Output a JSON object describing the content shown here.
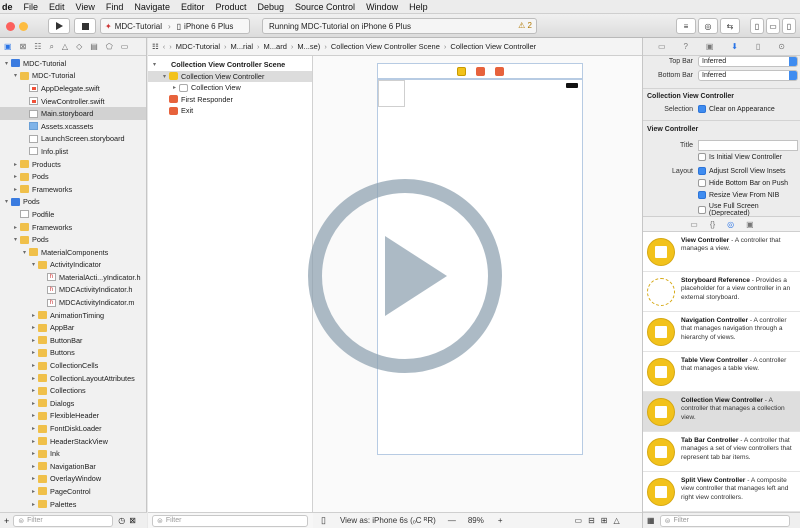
{
  "menubar": {
    "app": "de",
    "items": [
      "File",
      "Edit",
      "View",
      "Find",
      "Navigate",
      "Editor",
      "Product",
      "Debug",
      "Source Control",
      "Window",
      "Help"
    ]
  },
  "toolbar": {
    "scheme": "MDC-Tutorial",
    "device": "iPhone 6 Plus",
    "status": "Running MDC-Tutorial on iPhone 6 Plus",
    "warning_count": "2"
  },
  "navigator": {
    "tree": [
      {
        "label": "MDC-Tutorial",
        "indent": 0,
        "disc": "▾",
        "icon": "proj"
      },
      {
        "label": "MDC-Tutorial",
        "indent": 1,
        "disc": "▾",
        "icon": "folder"
      },
      {
        "label": "AppDelegate.swift",
        "indent": 2,
        "disc": "",
        "icon": "swift"
      },
      {
        "label": "ViewController.swift",
        "indent": 2,
        "disc": "",
        "icon": "swift"
      },
      {
        "label": "Main.storyboard",
        "indent": 2,
        "disc": "",
        "icon": "sb",
        "selected": true
      },
      {
        "label": "Assets.xcassets",
        "indent": 2,
        "disc": "",
        "icon": "assets"
      },
      {
        "label": "LaunchScreen.storyboard",
        "indent": 2,
        "disc": "",
        "icon": "sb"
      },
      {
        "label": "Info.plist",
        "indent": 2,
        "disc": "",
        "icon": "file"
      },
      {
        "label": "Products",
        "indent": 1,
        "disc": "▸",
        "icon": "folder"
      },
      {
        "label": "Pods",
        "indent": 1,
        "disc": "▸",
        "icon": "folder"
      },
      {
        "label": "Frameworks",
        "indent": 1,
        "disc": "▸",
        "icon": "folder"
      },
      {
        "label": "Pods",
        "indent": 0,
        "disc": "▾",
        "icon": "proj"
      },
      {
        "label": "Podfile",
        "indent": 1,
        "disc": "",
        "icon": "file"
      },
      {
        "label": "Frameworks",
        "indent": 1,
        "disc": "▸",
        "icon": "folder"
      },
      {
        "label": "Pods",
        "indent": 1,
        "disc": "▾",
        "icon": "folder"
      },
      {
        "label": "MaterialComponents",
        "indent": 2,
        "disc": "▾",
        "icon": "folder"
      },
      {
        "label": "ActivityIndicator",
        "indent": 3,
        "disc": "▾",
        "icon": "folder"
      },
      {
        "label": "MaterialActi...yIndicator.h",
        "indent": 4,
        "disc": "",
        "icon": "h"
      },
      {
        "label": "MDCActivityIndicator.h",
        "indent": 4,
        "disc": "",
        "icon": "h"
      },
      {
        "label": "MDCActivityIndicator.m",
        "indent": 4,
        "disc": "",
        "icon": "h"
      },
      {
        "label": "AnimationTiming",
        "indent": 3,
        "disc": "▸",
        "icon": "folder"
      },
      {
        "label": "AppBar",
        "indent": 3,
        "disc": "▸",
        "icon": "folder"
      },
      {
        "label": "ButtonBar",
        "indent": 3,
        "disc": "▸",
        "icon": "folder"
      },
      {
        "label": "Buttons",
        "indent": 3,
        "disc": "▸",
        "icon": "folder"
      },
      {
        "label": "CollectionCells",
        "indent": 3,
        "disc": "▸",
        "icon": "folder"
      },
      {
        "label": "CollectionLayoutAttributes",
        "indent": 3,
        "disc": "▸",
        "icon": "folder"
      },
      {
        "label": "Collections",
        "indent": 3,
        "disc": "▸",
        "icon": "folder"
      },
      {
        "label": "Dialogs",
        "indent": 3,
        "disc": "▸",
        "icon": "folder"
      },
      {
        "label": "FlexibleHeader",
        "indent": 3,
        "disc": "▸",
        "icon": "folder"
      },
      {
        "label": "FontDiskLoader",
        "indent": 3,
        "disc": "▸",
        "icon": "folder"
      },
      {
        "label": "HeaderStackView",
        "indent": 3,
        "disc": "▸",
        "icon": "folder"
      },
      {
        "label": "Ink",
        "indent": 3,
        "disc": "▸",
        "icon": "folder"
      },
      {
        "label": "NavigationBar",
        "indent": 3,
        "disc": "▸",
        "icon": "folder"
      },
      {
        "label": "OverlayWindow",
        "indent": 3,
        "disc": "▸",
        "icon": "folder"
      },
      {
        "label": "PageControl",
        "indent": 3,
        "disc": "▸",
        "icon": "folder"
      },
      {
        "label": "Palettes",
        "indent": 3,
        "disc": "▸",
        "icon": "folder"
      }
    ],
    "filter_placeholder": "Filter"
  },
  "jumpbar": {
    "crumbs": [
      "MDC-Tutorial",
      "M...rial",
      "M...ard",
      "M...se)",
      "Collection View Controller Scene",
      "Collection View Controller"
    ]
  },
  "outline": {
    "rows": [
      {
        "label": "Collection View Controller Scene",
        "indent": 0,
        "disc": "▾",
        "bold": true
      },
      {
        "label": "Collection View Controller",
        "indent": 1,
        "disc": "▾",
        "selected": true
      },
      {
        "label": "Collection View",
        "indent": 2,
        "disc": "▸"
      },
      {
        "label": "First Responder",
        "indent": 1,
        "disc": ""
      },
      {
        "label": "Exit",
        "indent": 1,
        "disc": ""
      }
    ],
    "filter_placeholder": "Filter"
  },
  "canvas": {
    "view_as": "View as: iPhone 6s (ₒC ᴿR)",
    "zoom": "89%",
    "zoom_minus": "—",
    "zoom_plus": "+"
  },
  "inspector": {
    "top_bar_label": "Top Bar",
    "top_bar_value": "Inferred",
    "bottom_bar_label": "Bottom Bar",
    "bottom_bar_value": "Inferred",
    "cvc_section": "Collection View Controller",
    "selection_label": "Selection",
    "clear_on_appearance": "Clear on Appearance",
    "vc_section": "View Controller",
    "title_label": "Title",
    "is_initial": "Is Initial View Controller",
    "layout_label": "Layout",
    "adjust_scroll": "Adjust Scroll View Insets",
    "hide_bottom_bar": "Hide Bottom Bar on Push",
    "resize_from_nib": "Resize View From NIB",
    "use_full_screen": "Use Full Screen (Deprecated)"
  },
  "library": {
    "items": [
      {
        "title": "View Controller",
        "desc": " - A controller that manages a view."
      },
      {
        "title": "Storyboard Reference",
        "desc": " - Provides a placeholder for a view controller in an external storyboard."
      },
      {
        "title": "Navigation Controller",
        "desc": " - A controller that manages navigation through a hierarchy of views."
      },
      {
        "title": "Table View Controller",
        "desc": " - A controller that manages a table view."
      },
      {
        "title": "Collection View Controller",
        "desc": " - A controller that manages a collection view.",
        "selected": true
      },
      {
        "title": "Tab Bar Controller",
        "desc": " - A controller that manages a set of view controllers that represent tab bar items."
      },
      {
        "title": "Split View Controller",
        "desc": " - A composite view controller that manages left and right view controllers."
      }
    ],
    "filter_placeholder": "Filter"
  }
}
